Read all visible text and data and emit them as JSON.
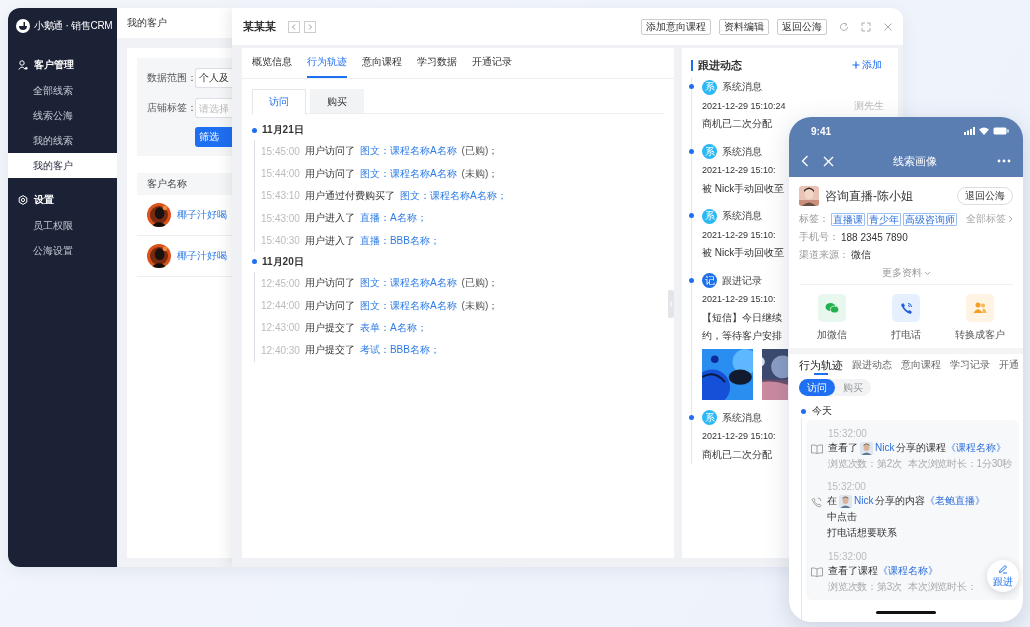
{
  "app": {
    "logo": "小鹅通 · 销售CRM"
  },
  "sidebar": {
    "groups": [
      {
        "label": "客户管理",
        "kind": "customers",
        "items": [
          {
            "label": "全部线索",
            "selected": false
          },
          {
            "label": "线索公海",
            "selected": false
          },
          {
            "label": "我的线索",
            "selected": false
          },
          {
            "label": "我的客户",
            "selected": true
          }
        ]
      },
      {
        "label": "设置",
        "kind": "settings",
        "items": [
          {
            "label": "员工权限",
            "selected": false
          },
          {
            "label": "公海设置",
            "selected": false
          }
        ]
      }
    ]
  },
  "list_page": {
    "breadcrumb": "我的客户",
    "filters": [
      {
        "label": "数据范围：",
        "kind": "select",
        "value": "个人及"
      },
      {
        "label": "店铺标签：",
        "kind": "input",
        "placeholder": "请选择"
      }
    ],
    "filter_button": "筛选",
    "table": {
      "columns": [
        "客户名称"
      ],
      "rows": [
        {
          "name": "椰子汁好喝"
        },
        {
          "name": "椰子汁好喝"
        }
      ]
    }
  },
  "drawer": {
    "title": "某某某",
    "actions": [
      "添加意向课程",
      "资料编辑",
      "返回公海"
    ],
    "tabs": [
      {
        "label": "概览信息",
        "selected": false
      },
      {
        "label": "行为轨迹",
        "selected": true
      },
      {
        "label": "意向课程",
        "selected": false
      },
      {
        "label": "学习数据",
        "selected": false
      },
      {
        "label": "开通记录",
        "selected": false
      }
    ],
    "subtabs": [
      {
        "label": "访问",
        "selected": true
      },
      {
        "label": "购买",
        "selected": false
      }
    ],
    "timeline": [
      {
        "date": "11月21日",
        "entries": [
          {
            "time": "15:45:00",
            "action": "用户访问了",
            "link": "图文：课程名称A名称",
            "suffix": "(已购)；"
          },
          {
            "time": "15:44:00",
            "action": "用户访问了",
            "link": "图文：课程名称A名称",
            "suffix": "(未购)；"
          },
          {
            "time": "15:43:10",
            "action": "用户通过付费购买了",
            "link": "图文：课程名称A名称；"
          },
          {
            "time": "15:43:00",
            "action": "用户进入了",
            "link": "直播：A名称；"
          },
          {
            "time": "15:40:30",
            "action": "用户进入了",
            "link": "直播：BBB名称；"
          }
        ]
      },
      {
        "date": "11月20日",
        "entries": [
          {
            "time": "12:45:00",
            "action": "用户访问了",
            "link": "图文：课程名称A名称",
            "suffix": "(已购)；"
          },
          {
            "time": "12:44:00",
            "action": "用户访问了",
            "link": "图文：课程名称A名称",
            "suffix": "(未购)；"
          },
          {
            "time": "12:43:00",
            "action": "用户提交了",
            "link": "表单：A名称；"
          },
          {
            "time": "12:40:30",
            "action": "用户提交了",
            "link": "考试：BBB名称；"
          }
        ]
      }
    ]
  },
  "follow": {
    "title": "跟进动态",
    "add": "添加",
    "items": [
      {
        "badge": "系",
        "color": "#2bb8f3",
        "title": "系统消息",
        "time": "2021-12-29 15:10:24",
        "author": "测先生",
        "lines": [
          "商机已二次分配"
        ]
      },
      {
        "badge": "系",
        "color": "#2bb8f3",
        "title": "系统消息",
        "time": "2021-12-29 15:10:",
        "lines": [
          "被 Nick手动回收至"
        ]
      },
      {
        "badge": "系",
        "color": "#2bb8f3",
        "title": "系统消息",
        "time": "2021-12-29 15:10:",
        "lines": [
          "被 Nick手动回收至"
        ]
      },
      {
        "badge": "记",
        "color": "#1f6fe8",
        "title": "跟进记录",
        "time": "2021-12-29 15:10:",
        "lines": [
          "【短信】今日继续",
          "约，等待客户安排"
        ],
        "images": [
          {
            "kind": "picture"
          },
          {
            "kind": "picture"
          }
        ]
      },
      {
        "badge": "系",
        "color": "#2bb8f3",
        "title": "系统消息",
        "time": "2021-12-29 15:10:",
        "lines": [
          "商机已二次分配"
        ]
      }
    ]
  },
  "phone": {
    "time": "9:41",
    "title": "线索画像",
    "name": "咨询直播-陈小姐",
    "return_button": "退回公海",
    "tags_label": "标签：",
    "tags": [
      "直播课",
      "青少年",
      "高级咨询师"
    ],
    "all_tags": "全部标签",
    "fields": [
      {
        "label": "手机号：",
        "value": "188 2345 7890"
      },
      {
        "label": "渠道来源：",
        "value": "微信"
      }
    ],
    "more": "更多资料",
    "actions": [
      {
        "label": "加微信",
        "kind": "wechat"
      },
      {
        "label": "打电话",
        "kind": "call"
      },
      {
        "label": "转换成客户",
        "kind": "convert"
      }
    ],
    "tabs": [
      {
        "label": "行为轨迹",
        "selected": true
      },
      {
        "label": "跟进动态",
        "selected": false
      },
      {
        "label": "意向课程",
        "selected": false
      },
      {
        "label": "学习记录",
        "selected": false
      },
      {
        "label": "开通",
        "selected": false
      }
    ],
    "subtabs": [
      {
        "label": "访问",
        "selected": true
      },
      {
        "label": "购买",
        "selected": false
      }
    ],
    "day": "今天",
    "entries": [
      {
        "kind": "view",
        "time": "15:32:00",
        "prefix": "查看了",
        "user": "Nick",
        "text": "分享的课程",
        "link": "《课程名称》",
        "meta": [
          "浏览次数：第2次",
          "本次浏览时长：1分30秒"
        ]
      },
      {
        "kind": "call",
        "time": "15:32:00",
        "prefix": "在",
        "user": "Nick",
        "text": "分享的内容",
        "link": "《老鲍直播》",
        "suffix": "中点击",
        "continuation": "打电话想要联系"
      },
      {
        "kind": "view",
        "time": "15:32:00",
        "text": "查看了课程",
        "link": "《课程名称》",
        "meta": [
          "浏览次数：第3次",
          "本次浏览时长："
        ]
      }
    ],
    "fab": "跟进"
  }
}
